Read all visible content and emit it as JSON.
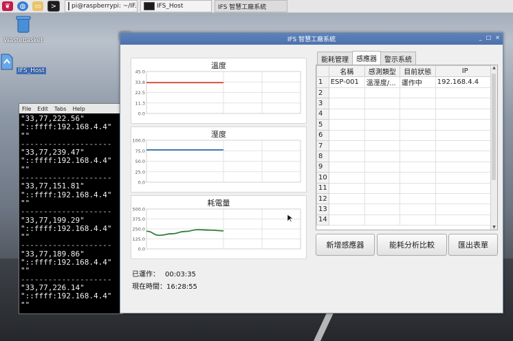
{
  "taskbar": {
    "tasks": [
      {
        "label": "pi@raspberrypi: ~/IF..."
      },
      {
        "label": "IFS_Host"
      },
      {
        "label": "IFS 智慧工廠系統"
      }
    ]
  },
  "desktop": {
    "icons": [
      {
        "label": "Wastebasket"
      },
      {
        "label": "IFS_Host"
      }
    ]
  },
  "terminal": {
    "menu": [
      "File",
      "Edit",
      "Tabs",
      "Help"
    ],
    "lines": [
      "\"33,77,222.56\"",
      "\"::ffff:192.168.4.4\"",
      "\"\"",
      "--------------------",
      "\"33,77,239.47\"",
      "\"::ffff:192.168.4.4\"",
      "\"\"",
      "--------------------",
      "\"33,77,151.81\"",
      "\"::ffff:192.168.4.4\"",
      "\"\"",
      "--------------------",
      "\"33,77,199.29\"",
      "\"::ffff:192.168.4.4\"",
      "\"\"",
      "--------------------",
      "\"33,77,189.86\"",
      "\"::ffff:192.168.4.4\"",
      "\"\"",
      "--------------------",
      "\"33,77,226.14\"",
      "\"::ffff:192.168.4.4\"",
      "\"\""
    ]
  },
  "window": {
    "title": "IFS 智慧工廠系統",
    "controls": [
      "_",
      "□",
      "×"
    ]
  },
  "chart_data": [
    {
      "type": "line",
      "title": "溫度",
      "yticks": [
        "45.0",
        "33.8",
        "22.5",
        "11.3",
        "0.0"
      ],
      "ylim": [
        0,
        45
      ],
      "x": [
        0,
        1,
        2,
        3,
        4,
        5,
        6
      ],
      "series": [
        {
          "color": "#d9412b",
          "values": [
            33,
            33,
            33,
            33,
            33,
            33,
            33
          ]
        }
      ],
      "xlim": [
        0,
        12
      ],
      "grid": true
    },
    {
      "type": "line",
      "title": "溼度",
      "yticks": [
        "100.0",
        "75.0",
        "50.0",
        "25.0",
        "0.0"
      ],
      "ylim": [
        0,
        100
      ],
      "x": [
        0,
        1,
        2,
        3,
        4,
        5,
        6
      ],
      "series": [
        {
          "color": "#2b6cb0",
          "values": [
            77,
            77,
            77,
            77,
            77,
            77,
            77
          ]
        }
      ],
      "xlim": [
        0,
        12
      ],
      "grid": true
    },
    {
      "type": "line",
      "title": "耗電量",
      "yticks": [
        "500.0",
        "375.0",
        "250.0",
        "125.0",
        "0.0"
      ],
      "ylim": [
        0,
        500
      ],
      "x": [
        0,
        1,
        2,
        3,
        4,
        5,
        6
      ],
      "series": [
        {
          "color": "#2e7d32",
          "values": [
            222,
            170,
            190,
            218,
            240,
            235,
            226
          ]
        }
      ],
      "xlim": [
        0,
        12
      ],
      "grid": true
    }
  ],
  "status": {
    "running_label": "已運作：",
    "running_value": "00:03:35",
    "time_label": "現在時間：",
    "time_value": "16:28:55"
  },
  "tabs": [
    "能耗管理",
    "感應器",
    "警示系統"
  ],
  "table": {
    "headers": [
      "名稱",
      "感測類型",
      "目前狀態",
      "IP"
    ],
    "rows": [
      [
        "ESP-001",
        "溫溼度/...",
        "運作中",
        "192.168.4.4"
      ],
      [
        "",
        "",
        "",
        ""
      ],
      [
        "",
        "",
        "",
        ""
      ],
      [
        "",
        "",
        "",
        ""
      ],
      [
        "",
        "",
        "",
        ""
      ],
      [
        "",
        "",
        "",
        ""
      ],
      [
        "",
        "",
        "",
        ""
      ],
      [
        "",
        "",
        "",
        ""
      ],
      [
        "",
        "",
        "",
        ""
      ],
      [
        "",
        "",
        "",
        ""
      ],
      [
        "",
        "",
        "",
        ""
      ],
      [
        "",
        "",
        "",
        ""
      ],
      [
        "",
        "",
        "",
        ""
      ],
      [
        "",
        "",
        "",
        ""
      ]
    ]
  },
  "buttons": {
    "add_sensor": "新增感應器",
    "compare": "能耗分析比較",
    "export": "匯出表單"
  }
}
